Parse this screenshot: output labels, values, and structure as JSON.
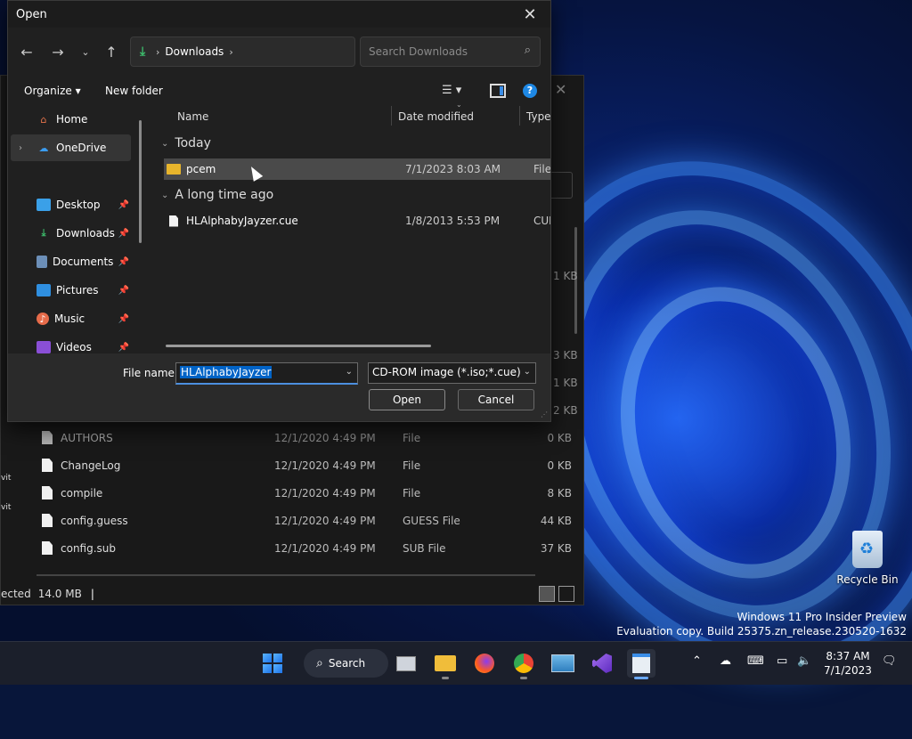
{
  "dialog": {
    "title": "Open",
    "address": {
      "crumb": "Downloads"
    },
    "search_placeholder": "Search Downloads",
    "toolbar": {
      "organize": "Organize",
      "new_folder": "New folder"
    },
    "sidebar": [
      {
        "label": "Home"
      },
      {
        "label": "OneDrive"
      },
      {
        "label": "Desktop"
      },
      {
        "label": "Downloads"
      },
      {
        "label": "Documents"
      },
      {
        "label": "Pictures"
      },
      {
        "label": "Music"
      },
      {
        "label": "Videos"
      }
    ],
    "columns": {
      "name": "Name",
      "date": "Date modified",
      "type": "Type"
    },
    "groups": [
      {
        "label": "Today",
        "files": [
          {
            "name": "pcem",
            "date": "7/1/2023 8:03 AM",
            "type": "File fo"
          }
        ]
      },
      {
        "label": "A long time ago",
        "files": [
          {
            "name": "HLAlphabyJayzer.cue",
            "date": "1/8/2013 5:53 PM",
            "type": "CUE F"
          }
        ]
      }
    ],
    "file_name_label": "File name:",
    "file_name_value": "HLAlphabyJayzer",
    "file_type_value": "CD-ROM image (*.iso;*.cue)",
    "open_button": "Open",
    "cancel_button": "Cancel"
  },
  "explorer": {
    "files": [
      {
        "name": "AUTHORS",
        "date": "12/1/2020 4:49 PM",
        "type": "File",
        "size": "0 KB"
      },
      {
        "name": "ChangeLog",
        "date": "12/1/2020 4:49 PM",
        "type": "File",
        "size": "0 KB"
      },
      {
        "name": "compile",
        "date": "12/1/2020 4:49 PM",
        "type": "File",
        "size": "8 KB"
      },
      {
        "name": "config.guess",
        "date": "12/1/2020 4:49 PM",
        "type": "GUESS File",
        "size": "44 KB"
      },
      {
        "name": "config.sub",
        "date": "12/1/2020 4:49 PM",
        "type": "SUB File",
        "size": "37 KB"
      }
    ],
    "partial_sizes": [
      "1 KB",
      "3 KB",
      "1 KB",
      "2 KB"
    ],
    "status": {
      "selected": "ected",
      "size": "14.0 MB",
      "separator": "|"
    },
    "left_edge": [
      "vit",
      "vit"
    ]
  },
  "desktop": {
    "recycle_bin": "Recycle Bin",
    "watermark_line1": "Windows 11 Pro Insider Preview",
    "watermark_line2": "Evaluation copy. Build 25375.zn_release.230520-1632"
  },
  "taskbar": {
    "search_label": "Search",
    "time": "8:37 AM",
    "date": "7/1/2023",
    "apps": [
      "start-icon",
      "task-view-icon",
      "file-explorer-icon",
      "firefox-icon",
      "chrome-icon",
      "control-panel-icon",
      "visual-studio-icon",
      "notepad-icon"
    ]
  },
  "colors": {
    "accent": "#0063c6",
    "folder": "#e8b52c",
    "downloads_icon": "#3dbb6b"
  }
}
